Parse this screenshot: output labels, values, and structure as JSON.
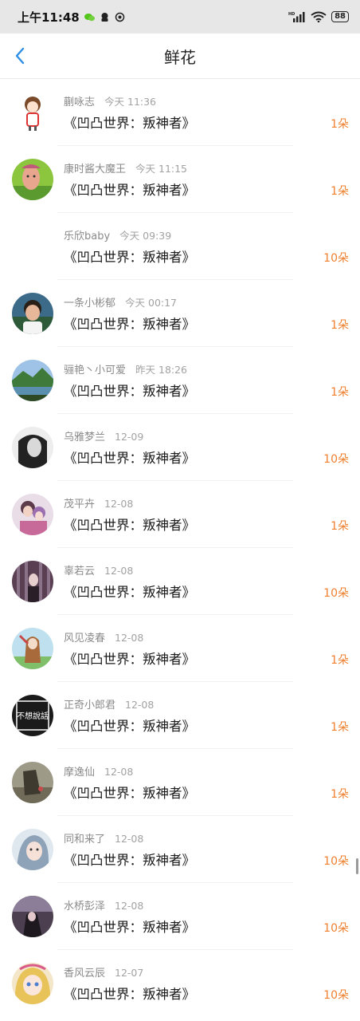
{
  "status_bar": {
    "time": "上午11:48",
    "battery": "88"
  },
  "nav": {
    "title": "鲜花",
    "back_icon": "chevron-left-icon"
  },
  "colors": {
    "accent": "#f07f2e",
    "back": "#2d8fe6"
  },
  "records": [
    {
      "name": "蒯咏志",
      "time": "今天 11:36",
      "book": "《凹凸世界：叛神者》",
      "count": "1朵"
    },
    {
      "name": "康时酱大魔王",
      "time": "今天 11:15",
      "book": "《凹凸世界：叛神者》",
      "count": "1朵"
    },
    {
      "name": "乐欣baby",
      "time": "今天 09:39",
      "book": "《凹凸世界：叛神者》",
      "count": "10朵"
    },
    {
      "name": "一条小彬郁",
      "time": "今天 00:17",
      "book": "《凹凸世界：叛神者》",
      "count": "1朵"
    },
    {
      "name": "骊艳丶小可爱",
      "time": "昨天 18:26",
      "book": "《凹凸世界：叛神者》",
      "count": "1朵"
    },
    {
      "name": "乌雅梦兰",
      "time": "12-09",
      "book": "《凹凸世界：叛神者》",
      "count": "10朵"
    },
    {
      "name": "茂平卉",
      "time": "12-08",
      "book": "《凹凸世界：叛神者》",
      "count": "1朵"
    },
    {
      "name": "辜若云",
      "time": "12-08",
      "book": "《凹凸世界：叛神者》",
      "count": "10朵"
    },
    {
      "name": "风见凌春",
      "time": "12-08",
      "book": "《凹凸世界：叛神者》",
      "count": "1朵"
    },
    {
      "name": "正奇小郎君",
      "time": "12-08",
      "book": "《凹凸世界：叛神者》",
      "count": "1朵",
      "avatar_text": "不想說話"
    },
    {
      "name": "摩逸仙",
      "time": "12-08",
      "book": "《凹凸世界：叛神者》",
      "count": "1朵"
    },
    {
      "name": "同和来了",
      "time": "12-08",
      "book": "《凹凸世界：叛神者》",
      "count": "10朵"
    },
    {
      "name": "水桥彭泽",
      "time": "12-08",
      "book": "《凹凸世界：叛神者》",
      "count": "10朵"
    },
    {
      "name": "香风云辰",
      "time": "12-07",
      "book": "《凹凸世界：叛神者》",
      "count": "10朵"
    }
  ]
}
